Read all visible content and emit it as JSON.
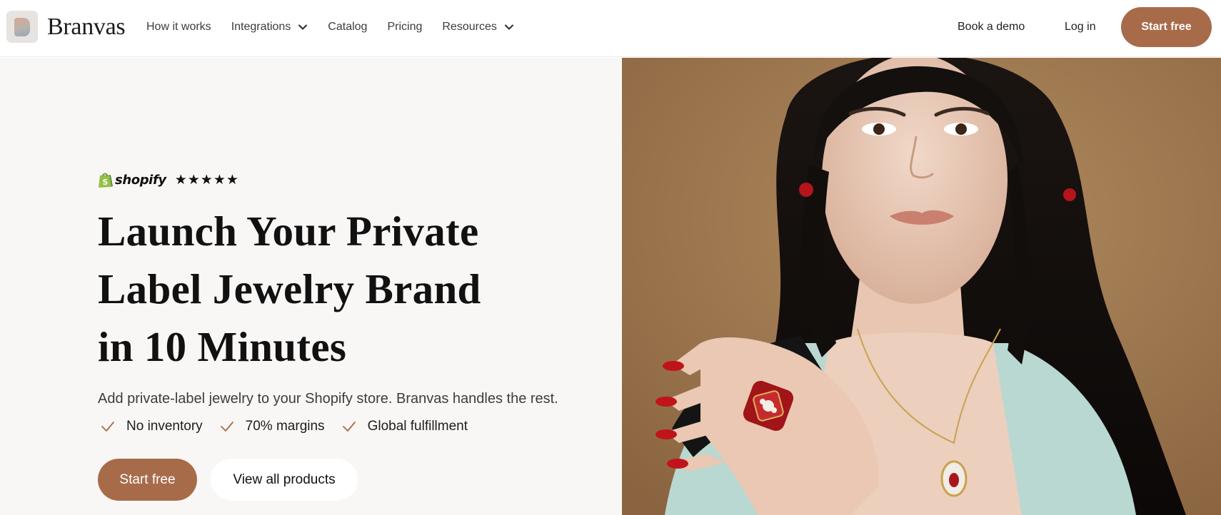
{
  "header": {
    "brand": "Branvas",
    "nav": [
      {
        "label": "How it works",
        "has_dropdown": false,
        "name": "nav-how-it-works"
      },
      {
        "label": "Integrations",
        "has_dropdown": true,
        "name": "nav-integrations"
      },
      {
        "label": "Catalog",
        "has_dropdown": false,
        "name": "nav-catalog"
      },
      {
        "label": "Pricing",
        "has_dropdown": false,
        "name": "nav-pricing"
      },
      {
        "label": "Resources",
        "has_dropdown": true,
        "name": "nav-resources"
      }
    ],
    "book_demo": "Book a demo",
    "login": "Log in",
    "start_free": "Start free"
  },
  "hero": {
    "badge_platform": "shopify",
    "rating_stars": 5,
    "rating_display": "★★★★★",
    "headline_lines": [
      "Launch Your Private",
      "Label Jewelry Brand",
      "in 10 Minutes"
    ],
    "subtext": "Add private-label jewelry to your Shopify store. Branvas handles the rest.",
    "checks": [
      "No inventory",
      "70% margins",
      "Global fulfillment"
    ],
    "cta_primary": "Start free",
    "cta_secondary": "View all products"
  },
  "colors": {
    "accent": "#a86b4a",
    "hero_bg": "#f9f7f5",
    "check": "#a86b4a",
    "image_bg": "#9c7448"
  },
  "icons": {
    "logo": "branvas-logo-icon",
    "dropdown": "chevron-down-icon",
    "check": "check-icon",
    "shopify": "shopify-bag-icon",
    "star": "star-icon"
  }
}
